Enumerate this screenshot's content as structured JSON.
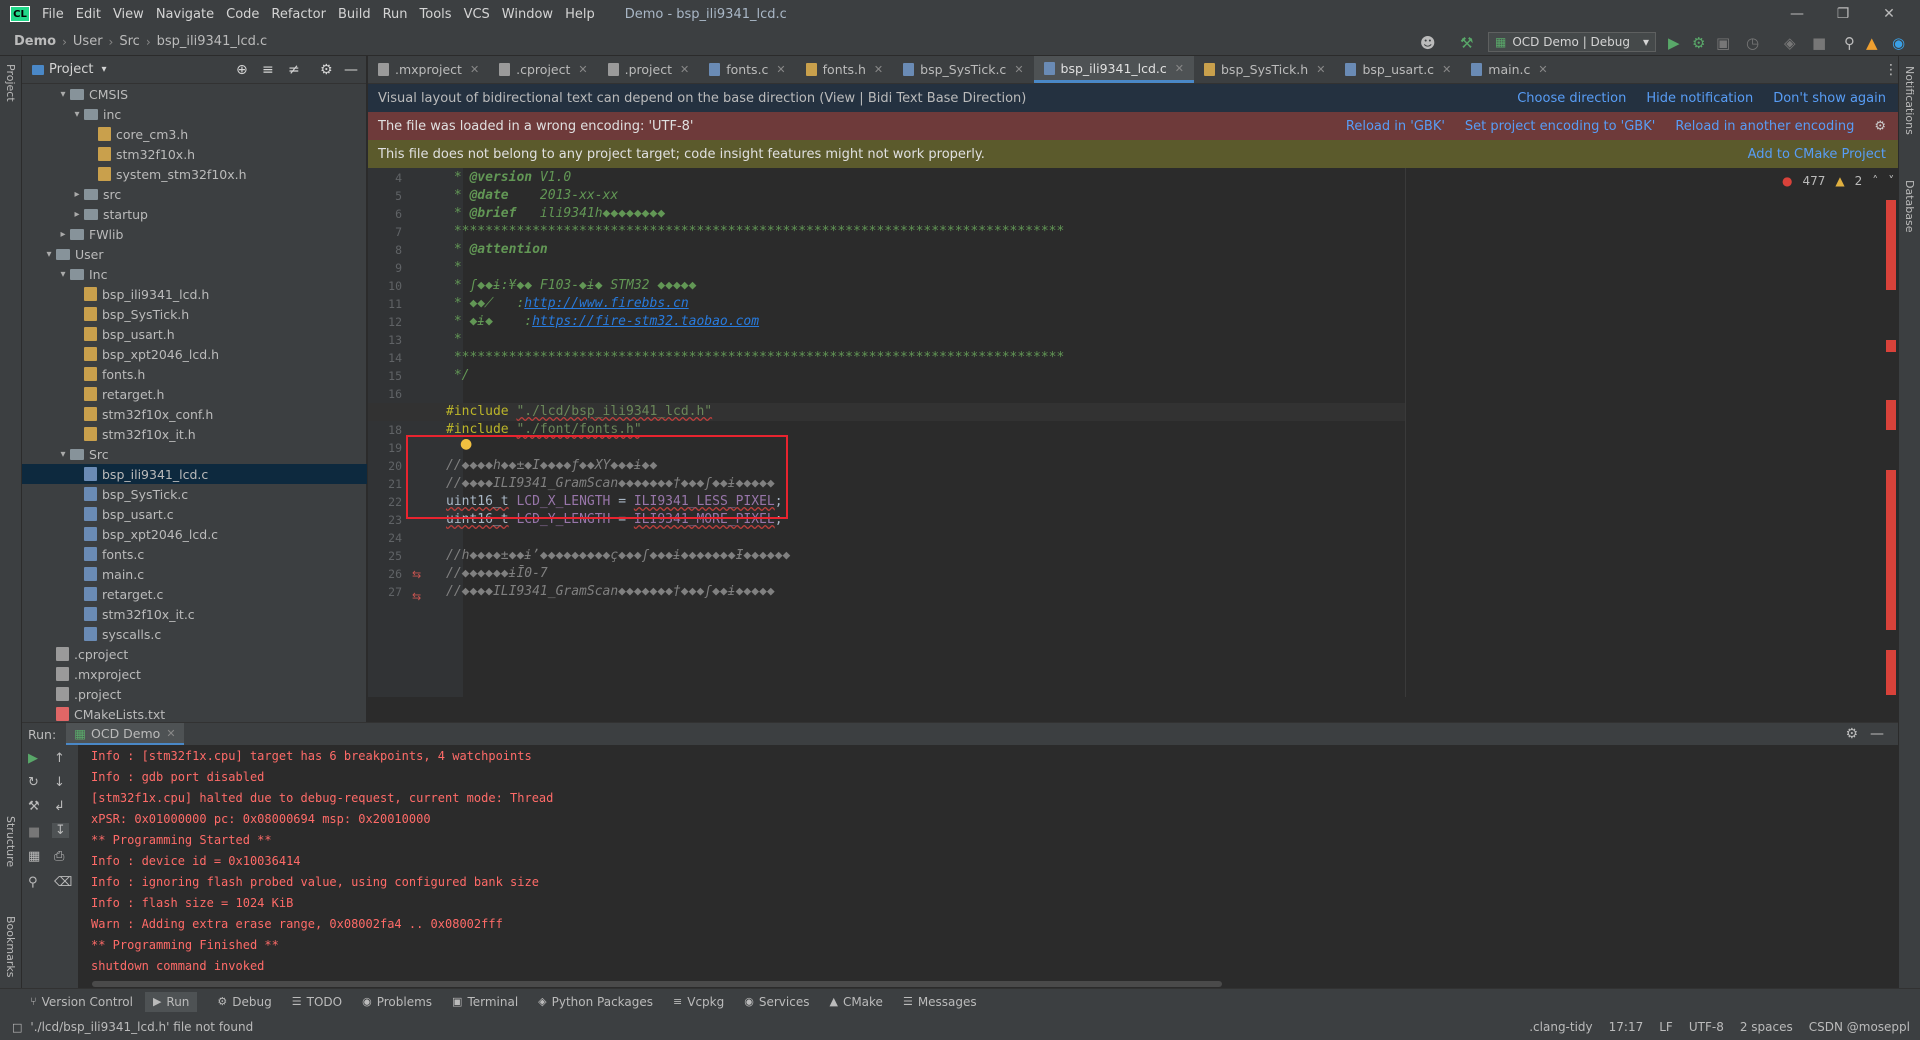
{
  "window": {
    "title": "Demo - bsp_ili9341_lcd.c",
    "app_logo": "CL"
  },
  "menu": [
    "File",
    "Edit",
    "View",
    "Navigate",
    "Code",
    "Refactor",
    "Build",
    "Run",
    "Tools",
    "VCS",
    "Window",
    "Help"
  ],
  "breadcrumb": [
    "Demo",
    "User",
    "Src",
    "bsp_ili9341_lcd.c"
  ],
  "run_config": "OCD Demo | Debug",
  "project_panel": {
    "title": "Project"
  },
  "tree": [
    {
      "label": "CMSIS",
      "type": "folder",
      "depth": 2,
      "open": true
    },
    {
      "label": "inc",
      "type": "folder",
      "depth": 3,
      "open": true
    },
    {
      "label": "core_cm3.h",
      "type": "h",
      "depth": 4
    },
    {
      "label": "stm32f10x.h",
      "type": "h",
      "depth": 4
    },
    {
      "label": "system_stm32f10x.h",
      "type": "h",
      "depth": 4
    },
    {
      "label": "src",
      "type": "folder",
      "depth": 3,
      "open": false
    },
    {
      "label": "startup",
      "type": "folder",
      "depth": 3,
      "open": false
    },
    {
      "label": "FWlib",
      "type": "folder",
      "depth": 2,
      "open": false
    },
    {
      "label": "User",
      "type": "folder",
      "depth": 1,
      "open": true
    },
    {
      "label": "Inc",
      "type": "folder",
      "depth": 2,
      "open": true
    },
    {
      "label": "bsp_ili9341_lcd.h",
      "type": "h",
      "depth": 3
    },
    {
      "label": "bsp_SysTick.h",
      "type": "h",
      "depth": 3
    },
    {
      "label": "bsp_usart.h",
      "type": "h",
      "depth": 3
    },
    {
      "label": "bsp_xpt2046_lcd.h",
      "type": "h",
      "depth": 3
    },
    {
      "label": "fonts.h",
      "type": "h",
      "depth": 3
    },
    {
      "label": "retarget.h",
      "type": "h",
      "depth": 3
    },
    {
      "label": "stm32f10x_conf.h",
      "type": "h",
      "depth": 3
    },
    {
      "label": "stm32f10x_it.h",
      "type": "h",
      "depth": 3
    },
    {
      "label": "Src",
      "type": "folder",
      "depth": 2,
      "open": true
    },
    {
      "label": "bsp_ili9341_lcd.c",
      "type": "c",
      "depth": 3,
      "selected": true
    },
    {
      "label": "bsp_SysTick.c",
      "type": "c",
      "depth": 3
    },
    {
      "label": "bsp_usart.c",
      "type": "c",
      "depth": 3
    },
    {
      "label": "bsp_xpt2046_lcd.c",
      "type": "c",
      "depth": 3
    },
    {
      "label": "fonts.c",
      "type": "c",
      "depth": 3
    },
    {
      "label": "main.c",
      "type": "c",
      "depth": 3
    },
    {
      "label": "retarget.c",
      "type": "c",
      "depth": 3
    },
    {
      "label": "stm32f10x_it.c",
      "type": "c",
      "depth": 3
    },
    {
      "label": "syscalls.c",
      "type": "c",
      "depth": 3
    },
    {
      "label": ".cproject",
      "type": "t",
      "depth": 1
    },
    {
      "label": ".mxproject",
      "type": "t",
      "depth": 1
    },
    {
      "label": ".project",
      "type": "t",
      "depth": 1
    },
    {
      "label": "CMakeLists.txt",
      "type": "m",
      "depth": 1
    }
  ],
  "tabs": [
    {
      "label": ".mxproject",
      "type": "t"
    },
    {
      "label": ".cproject",
      "type": "t"
    },
    {
      "label": ".project",
      "type": "t"
    },
    {
      "label": "fonts.c",
      "type": "c"
    },
    {
      "label": "fonts.h",
      "type": "h"
    },
    {
      "label": "bsp_SysTick.c",
      "type": "c"
    },
    {
      "label": "bsp_ili9341_lcd.c",
      "type": "c",
      "active": true
    },
    {
      "label": "bsp_SysTick.h",
      "type": "h"
    },
    {
      "label": "bsp_usart.c",
      "type": "c"
    },
    {
      "label": "main.c",
      "type": "c"
    }
  ],
  "banners": {
    "bidi": {
      "text": "Visual layout of bidirectional text can depend on the base direction (View | Bidi Text Base Direction)",
      "actions": [
        "Choose direction",
        "Hide notification",
        "Don't show again"
      ]
    },
    "encoding": {
      "text": "The file was loaded in a wrong encoding: 'UTF-8'",
      "actions": [
        "Reload in 'GBK'",
        "Set project encoding to 'GBK'",
        "Reload in another encoding"
      ]
    },
    "target": {
      "text": "This file does not belong to any project target; code insight features might not work properly.",
      "actions": [
        "Add to CMake Project"
      ]
    }
  },
  "inspections": {
    "errors": "477",
    "warnings": "2"
  },
  "code_lines": [
    {
      "n": "4",
      "html": "<span class='cm'> * </span><span class='dtag'>@version</span><span class='cm'> V1.0</span>"
    },
    {
      "n": "5",
      "html": "<span class='cm'> * </span><span class='dtag'>@date</span><span class='cm'>    2013-xx-xx</span>"
    },
    {
      "n": "6",
      "html": "<span class='cm'> * </span><span class='dtag'>@brief</span><span class='cm'>   ili9341h◆◆◆◆◆◆◆◆</span>"
    },
    {
      "n": "7",
      "html": "<span class='cm'> ******************************************************************************</span>"
    },
    {
      "n": "8",
      "html": "<span class='cm'> * </span><span class='dtag'>@attention</span>"
    },
    {
      "n": "9",
      "html": "<span class='cm'> *</span>"
    },
    {
      "n": "10",
      "html": "<span class='cm'> * ʃ◆◆ɨ:¥◆◆ F103-◆ɨ◆ STM32 ◆◆◆◆◆</span>"
    },
    {
      "n": "11",
      "html": "<span class='cm'> * ◆◆̸   :</span><span class='cm lnk'>http://www.firebbs.cn</span>"
    },
    {
      "n": "12",
      "html": "<span class='cm'> * ◆ɨ◆    :</span><span class='cm lnk'>https://fire-stm32.taobao.com</span>"
    },
    {
      "n": "13",
      "html": "<span class='cm'> *</span>"
    },
    {
      "n": "14",
      "html": "<span class='cm'> ******************************************************************************</span>"
    },
    {
      "n": "15",
      "html": "<span class='cm'> */</span>"
    },
    {
      "n": "16",
      "html": ""
    },
    {
      "n": "17",
      "html": "<span class='pp'>#include</span> <span class='str und'>\"./lcd/bsp_ili9341_lcd.h\"</span>",
      "current": true
    },
    {
      "n": "18",
      "html": "<span class='pp'>#include</span> <span class='str und'>\"./font/fonts.h\"</span>"
    },
    {
      "n": "19",
      "html": ""
    },
    {
      "n": "20",
      "html": "<span class='gc'>//◆◆◆◆h◆◆±◆Ι◆◆◆◆ƒ◆◆XY◆◆◆ɨ◆◆</span>"
    },
    {
      "n": "21",
      "html": "<span class='gc'>//◆◆◆◆ILI9341_GramScan◆◆◆◆◆◆◆†◆◆◆ʃ◆◆ɨ◆◆◆◆◆</span>"
    },
    {
      "n": "22",
      "html": "<span class='und'>uint16_t</span> <span class='mac'>LCD_X_LENGTH</span> = <span class='mac und'>ILI9341_LESS_PIXEL</span>;"
    },
    {
      "n": "23",
      "html": "<span class='und'>uint16_t</span> <span class='mac'>LCD_Y_LENGTH</span> = <span class='mac und'>ILI9341_MORE_PIXEL</span>;"
    },
    {
      "n": "24",
      "html": ""
    },
    {
      "n": "25",
      "html": "<span class='gc'>//h◆◆◆◆±◆◆ɨʼ◆◆◆◆◆◆◆◆◆ç◆◆◆ʃ◆◆◆ɨ◆◆◆◆◆◆◆Ɨ◆◆◆◆◆◆</span>"
    },
    {
      "n": "26",
      "html": "<span class='gc'>//◆◆◆◆◆◆ɨĪ0-7</span>"
    },
    {
      "n": "27",
      "html": "<span class='gc'>//◆◆◆◆ILI9341_GramScan◆◆◆◆◆◆◆†◆◆◆ʃ◆◆ɨ◆◆◆◆◆</span>"
    }
  ],
  "run_panel": {
    "label": "Run:",
    "tab": "OCD Demo",
    "output": [
      "Info : [stm32f1x.cpu] target has 6 breakpoints, 4 watchpoints",
      "Info : gdb port disabled",
      "[stm32f1x.cpu] halted due to debug-request, current mode: Thread",
      "xPSR: 0x01000000 pc: 0x08000694 msp: 0x20010000",
      "** Programming Started **",
      "Info : device id = 0x10036414",
      "Info : ignoring flash probed value, using configured bank size",
      "Info : flash size = 1024 KiB",
      "Warn : Adding extra erase range, 0x08002fa4 .. 0x08002fff",
      "** Programming Finished **",
      "shutdown command invoked"
    ]
  },
  "tool_windows": [
    "Version Control",
    "Run",
    "Debug",
    "TODO",
    "Problems",
    "Terminal",
    "Python Packages",
    "Vcpkg",
    "Services",
    "CMake",
    "Messages"
  ],
  "side_labels": {
    "left_top": "Project",
    "left_mid": "Structure",
    "left_bot": "Bookmarks",
    "right_top": "Notifications",
    "right_mid": "Database"
  },
  "status": {
    "message": "'./lcd/bsp_ili9341_lcd.h' file not found",
    "items": [
      ".clang-tidy",
      "17:17",
      "LF",
      "UTF-8",
      "2 spaces",
      "CSDN @moseppl"
    ]
  },
  "colors": {
    "accent": "#4a88c7",
    "error": "#d9423a",
    "redbox": "#e8242f"
  }
}
